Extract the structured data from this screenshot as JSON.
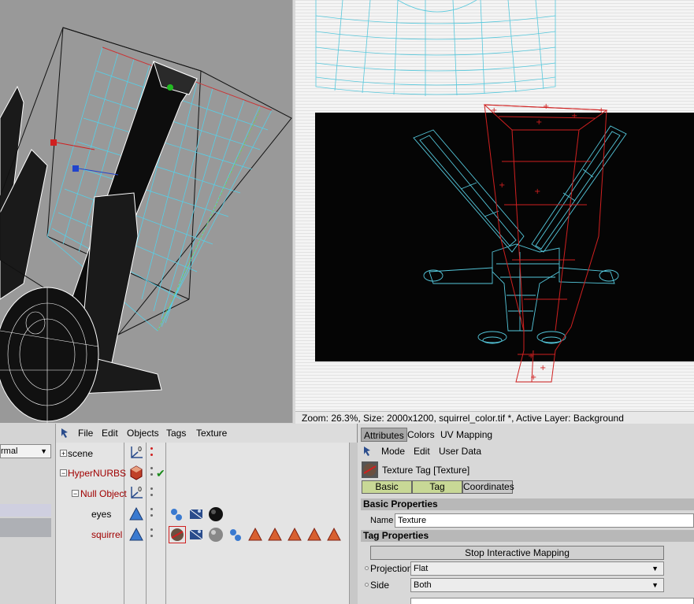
{
  "status_bar": {
    "text": "Zoom: 26.3%, Size: 2000x1200, squirrel_color.tif *, Active Layer: Background"
  },
  "left_panel": {
    "mode_value": "rmal"
  },
  "object_manager": {
    "menu": [
      "File",
      "Edit",
      "Objects",
      "Tags",
      "Texture"
    ],
    "objects": [
      {
        "name": "scene",
        "tree": "+",
        "color": "#000000",
        "icon": "null-axis-icon"
      },
      {
        "name": "HyperNURBS",
        "tree": "−",
        "color": "#a00000",
        "icon": "hypernurbs-icon"
      },
      {
        "name": "Null Object",
        "tree": "−",
        "color": "#a00000",
        "icon": "null-axis-icon"
      },
      {
        "name": "eyes",
        "tree": "",
        "color": "#000000",
        "icon": "polygon-object-icon"
      },
      {
        "name": "squirrel",
        "tree": "",
        "color": "#a00000",
        "icon": "polygon-object-icon"
      }
    ]
  },
  "attributes": {
    "tabs": [
      "Attributes",
      "Colors",
      "UV Mapping"
    ],
    "menu": [
      "Mode",
      "Edit",
      "User Data"
    ],
    "title": "Texture Tag [Texture]",
    "subtabs": [
      "Basic",
      "Tag",
      "Coordinates"
    ],
    "basic_properties": {
      "heading": "Basic Properties",
      "name_label": "Name",
      "name_value": "Texture"
    },
    "tag_properties": {
      "heading": "Tag Properties",
      "stop_button": "Stop Interactive Mapping",
      "projection_label": "Projection",
      "projection_value": "Flat",
      "side_label": "Side",
      "side_value": "Both"
    }
  },
  "colors": {
    "viewport_bg": "#999999",
    "uv_wire": "#55c8dc",
    "uv_selected": "#d02020",
    "texture_bg": "#050505",
    "subtab_green": "#c8d896"
  }
}
